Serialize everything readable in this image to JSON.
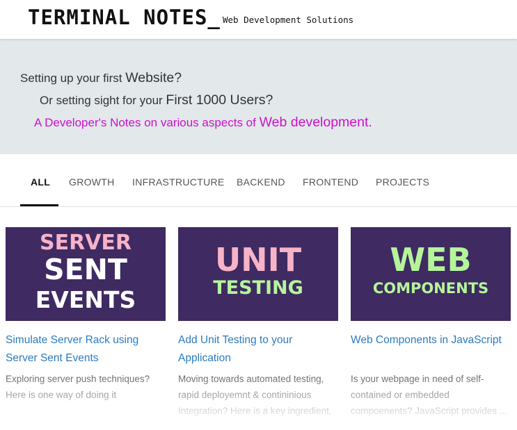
{
  "header": {
    "brand": "TERMINAL NOTES_",
    "tagline": "Web Development Solutions"
  },
  "hero": {
    "line1_pre": "Setting up your first ",
    "line1_em": "Website?",
    "line2_pre": "Or setting sight for your ",
    "line2_em": "First 1000 Users?",
    "line3_pre": "A Developer's Notes on various aspects of ",
    "line3_em": "Web development."
  },
  "tabs": [
    {
      "label": "ALL",
      "active": true
    },
    {
      "label": "GROWTH"
    },
    {
      "label": "INFRASTRUCTURE"
    },
    {
      "label": "BACKEND"
    },
    {
      "label": "FRONTEND"
    },
    {
      "label": "PROJECTS"
    }
  ],
  "cards": [
    {
      "thumb": [
        "SERVER",
        "SENT",
        "EVENTS"
      ],
      "title": "Simulate Server Rack using Server Sent Events",
      "desc": "Exploring server push techniques? Here is one way of doing it"
    },
    {
      "thumb": [
        "UNIT",
        "TESTING"
      ],
      "title": "Add Unit Testing to your Application",
      "desc": "Moving towards automated testing, rapid deployemnt & contininious Integration? Here is a key ingredient."
    },
    {
      "thumb": [
        "WEB",
        "COMPONENTS"
      ],
      "title": "Web Components in JavaScript",
      "desc": "Is your webpage in need of self-contained or embedded compoenents? JavaScript provides ..."
    }
  ],
  "colors": {
    "accent_magenta": "#cc11cc",
    "link_blue": "#2b7bbf",
    "thumb_bg": "#3f2a62",
    "thumb_pink": "#f7b3c8",
    "thumb_green": "#b5f59a",
    "hero_bg": "#e3e8ea"
  }
}
